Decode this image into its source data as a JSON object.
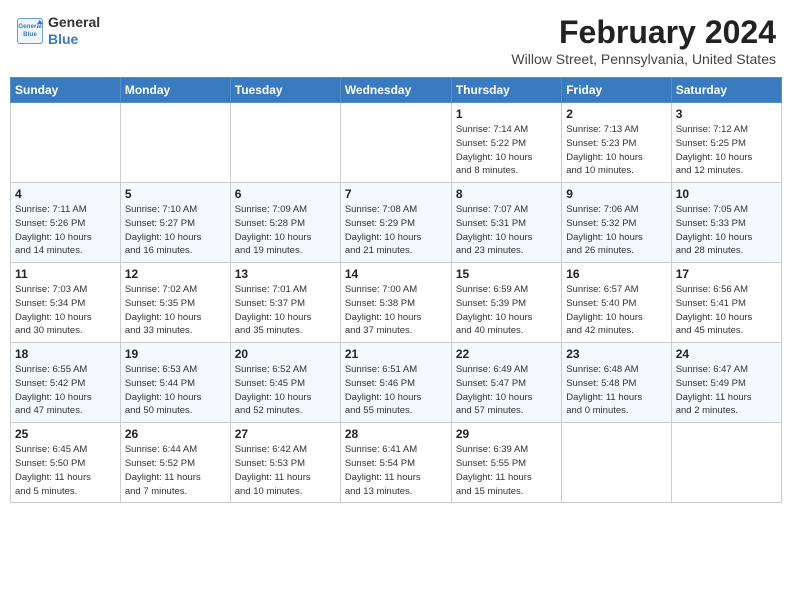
{
  "header": {
    "logo_line1": "General",
    "logo_line2": "Blue",
    "title": "February 2024",
    "subtitle": "Willow Street, Pennsylvania, United States"
  },
  "columns": [
    "Sunday",
    "Monday",
    "Tuesday",
    "Wednesday",
    "Thursday",
    "Friday",
    "Saturday"
  ],
  "weeks": [
    [
      {
        "day": "",
        "info": ""
      },
      {
        "day": "",
        "info": ""
      },
      {
        "day": "",
        "info": ""
      },
      {
        "day": "",
        "info": ""
      },
      {
        "day": "1",
        "info": "Sunrise: 7:14 AM\nSunset: 5:22 PM\nDaylight: 10 hours\nand 8 minutes."
      },
      {
        "day": "2",
        "info": "Sunrise: 7:13 AM\nSunset: 5:23 PM\nDaylight: 10 hours\nand 10 minutes."
      },
      {
        "day": "3",
        "info": "Sunrise: 7:12 AM\nSunset: 5:25 PM\nDaylight: 10 hours\nand 12 minutes."
      }
    ],
    [
      {
        "day": "4",
        "info": "Sunrise: 7:11 AM\nSunset: 5:26 PM\nDaylight: 10 hours\nand 14 minutes."
      },
      {
        "day": "5",
        "info": "Sunrise: 7:10 AM\nSunset: 5:27 PM\nDaylight: 10 hours\nand 16 minutes."
      },
      {
        "day": "6",
        "info": "Sunrise: 7:09 AM\nSunset: 5:28 PM\nDaylight: 10 hours\nand 19 minutes."
      },
      {
        "day": "7",
        "info": "Sunrise: 7:08 AM\nSunset: 5:29 PM\nDaylight: 10 hours\nand 21 minutes."
      },
      {
        "day": "8",
        "info": "Sunrise: 7:07 AM\nSunset: 5:31 PM\nDaylight: 10 hours\nand 23 minutes."
      },
      {
        "day": "9",
        "info": "Sunrise: 7:06 AM\nSunset: 5:32 PM\nDaylight: 10 hours\nand 26 minutes."
      },
      {
        "day": "10",
        "info": "Sunrise: 7:05 AM\nSunset: 5:33 PM\nDaylight: 10 hours\nand 28 minutes."
      }
    ],
    [
      {
        "day": "11",
        "info": "Sunrise: 7:03 AM\nSunset: 5:34 PM\nDaylight: 10 hours\nand 30 minutes."
      },
      {
        "day": "12",
        "info": "Sunrise: 7:02 AM\nSunset: 5:35 PM\nDaylight: 10 hours\nand 33 minutes."
      },
      {
        "day": "13",
        "info": "Sunrise: 7:01 AM\nSunset: 5:37 PM\nDaylight: 10 hours\nand 35 minutes."
      },
      {
        "day": "14",
        "info": "Sunrise: 7:00 AM\nSunset: 5:38 PM\nDaylight: 10 hours\nand 37 minutes."
      },
      {
        "day": "15",
        "info": "Sunrise: 6:59 AM\nSunset: 5:39 PM\nDaylight: 10 hours\nand 40 minutes."
      },
      {
        "day": "16",
        "info": "Sunrise: 6:57 AM\nSunset: 5:40 PM\nDaylight: 10 hours\nand 42 minutes."
      },
      {
        "day": "17",
        "info": "Sunrise: 6:56 AM\nSunset: 5:41 PM\nDaylight: 10 hours\nand 45 minutes."
      }
    ],
    [
      {
        "day": "18",
        "info": "Sunrise: 6:55 AM\nSunset: 5:42 PM\nDaylight: 10 hours\nand 47 minutes."
      },
      {
        "day": "19",
        "info": "Sunrise: 6:53 AM\nSunset: 5:44 PM\nDaylight: 10 hours\nand 50 minutes."
      },
      {
        "day": "20",
        "info": "Sunrise: 6:52 AM\nSunset: 5:45 PM\nDaylight: 10 hours\nand 52 minutes."
      },
      {
        "day": "21",
        "info": "Sunrise: 6:51 AM\nSunset: 5:46 PM\nDaylight: 10 hours\nand 55 minutes."
      },
      {
        "day": "22",
        "info": "Sunrise: 6:49 AM\nSunset: 5:47 PM\nDaylight: 10 hours\nand 57 minutes."
      },
      {
        "day": "23",
        "info": "Sunrise: 6:48 AM\nSunset: 5:48 PM\nDaylight: 11 hours\nand 0 minutes."
      },
      {
        "day": "24",
        "info": "Sunrise: 6:47 AM\nSunset: 5:49 PM\nDaylight: 11 hours\nand 2 minutes."
      }
    ],
    [
      {
        "day": "25",
        "info": "Sunrise: 6:45 AM\nSunset: 5:50 PM\nDaylight: 11 hours\nand 5 minutes."
      },
      {
        "day": "26",
        "info": "Sunrise: 6:44 AM\nSunset: 5:52 PM\nDaylight: 11 hours\nand 7 minutes."
      },
      {
        "day": "27",
        "info": "Sunrise: 6:42 AM\nSunset: 5:53 PM\nDaylight: 11 hours\nand 10 minutes."
      },
      {
        "day": "28",
        "info": "Sunrise: 6:41 AM\nSunset: 5:54 PM\nDaylight: 11 hours\nand 13 minutes."
      },
      {
        "day": "29",
        "info": "Sunrise: 6:39 AM\nSunset: 5:55 PM\nDaylight: 11 hours\nand 15 minutes."
      },
      {
        "day": "",
        "info": ""
      },
      {
        "day": "",
        "info": ""
      }
    ]
  ]
}
